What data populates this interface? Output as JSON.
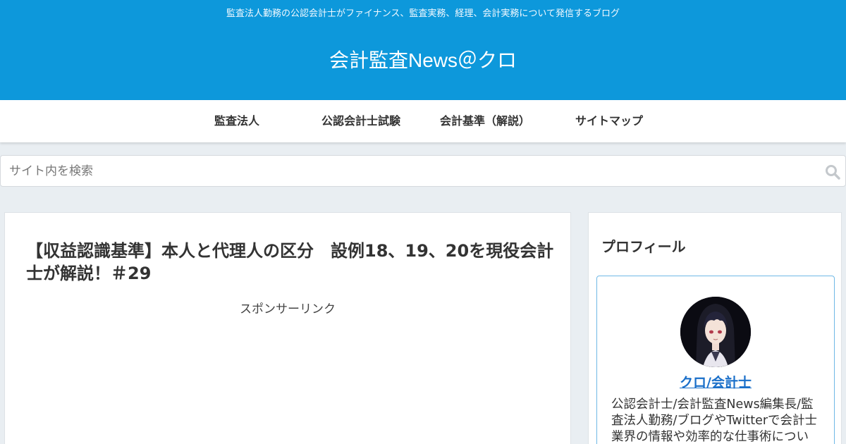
{
  "header": {
    "tagline": "監査法人勤務の公認会計士がファイナンス、監査実務、経理、会計実務について発信するブログ",
    "site_title": "会計監査News＠クロ"
  },
  "nav": {
    "items": [
      {
        "label": "監査法人"
      },
      {
        "label": "公認会計士試験"
      },
      {
        "label": "会計基準（解説）"
      },
      {
        "label": "サイトマップ"
      }
    ]
  },
  "search": {
    "placeholder": "サイト内を検索",
    "value": ""
  },
  "article": {
    "title": "【収益認識基準】本人と代理人の区分　設例18、19、20を現役会計士が解説！＃29",
    "sponsor_label": "スポンサーリンク"
  },
  "sidebar": {
    "widget_title": "プロフィール",
    "profile": {
      "name": "クロ/会計士",
      "description": "公認会計士/会計監査News編集長/監査法人勤務/ブログやTwitterで会計士業界の情報や効率的な仕事術につい"
    }
  },
  "colors": {
    "header_bg": "#0d98db",
    "link": "#1a6fc9",
    "page_bg": "#e9eef2"
  },
  "icons": {
    "search": "search-icon",
    "avatar": "anime-character-avatar"
  }
}
